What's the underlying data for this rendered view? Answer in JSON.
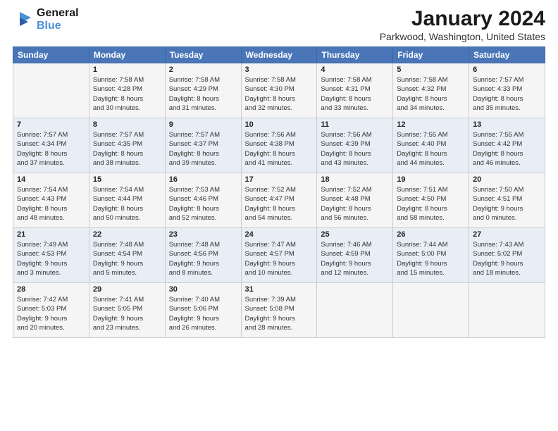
{
  "logo": {
    "line1": "General",
    "line2": "Blue"
  },
  "title": "January 2024",
  "location": "Parkwood, Washington, United States",
  "weekdays": [
    "Sunday",
    "Monday",
    "Tuesday",
    "Wednesday",
    "Thursday",
    "Friday",
    "Saturday"
  ],
  "weeks": [
    [
      {
        "day": "",
        "info": ""
      },
      {
        "day": "1",
        "info": "Sunrise: 7:58 AM\nSunset: 4:28 PM\nDaylight: 8 hours\nand 30 minutes."
      },
      {
        "day": "2",
        "info": "Sunrise: 7:58 AM\nSunset: 4:29 PM\nDaylight: 8 hours\nand 31 minutes."
      },
      {
        "day": "3",
        "info": "Sunrise: 7:58 AM\nSunset: 4:30 PM\nDaylight: 8 hours\nand 32 minutes."
      },
      {
        "day": "4",
        "info": "Sunrise: 7:58 AM\nSunset: 4:31 PM\nDaylight: 8 hours\nand 33 minutes."
      },
      {
        "day": "5",
        "info": "Sunrise: 7:58 AM\nSunset: 4:32 PM\nDaylight: 8 hours\nand 34 minutes."
      },
      {
        "day": "6",
        "info": "Sunrise: 7:57 AM\nSunset: 4:33 PM\nDaylight: 8 hours\nand 35 minutes."
      }
    ],
    [
      {
        "day": "7",
        "info": "Sunrise: 7:57 AM\nSunset: 4:34 PM\nDaylight: 8 hours\nand 37 minutes."
      },
      {
        "day": "8",
        "info": "Sunrise: 7:57 AM\nSunset: 4:35 PM\nDaylight: 8 hours\nand 38 minutes."
      },
      {
        "day": "9",
        "info": "Sunrise: 7:57 AM\nSunset: 4:37 PM\nDaylight: 8 hours\nand 39 minutes."
      },
      {
        "day": "10",
        "info": "Sunrise: 7:56 AM\nSunset: 4:38 PM\nDaylight: 8 hours\nand 41 minutes."
      },
      {
        "day": "11",
        "info": "Sunrise: 7:56 AM\nSunset: 4:39 PM\nDaylight: 8 hours\nand 43 minutes."
      },
      {
        "day": "12",
        "info": "Sunrise: 7:55 AM\nSunset: 4:40 PM\nDaylight: 8 hours\nand 44 minutes."
      },
      {
        "day": "13",
        "info": "Sunrise: 7:55 AM\nSunset: 4:42 PM\nDaylight: 8 hours\nand 46 minutes."
      }
    ],
    [
      {
        "day": "14",
        "info": "Sunrise: 7:54 AM\nSunset: 4:43 PM\nDaylight: 8 hours\nand 48 minutes."
      },
      {
        "day": "15",
        "info": "Sunrise: 7:54 AM\nSunset: 4:44 PM\nDaylight: 8 hours\nand 50 minutes."
      },
      {
        "day": "16",
        "info": "Sunrise: 7:53 AM\nSunset: 4:46 PM\nDaylight: 8 hours\nand 52 minutes."
      },
      {
        "day": "17",
        "info": "Sunrise: 7:52 AM\nSunset: 4:47 PM\nDaylight: 8 hours\nand 54 minutes."
      },
      {
        "day": "18",
        "info": "Sunrise: 7:52 AM\nSunset: 4:48 PM\nDaylight: 8 hours\nand 56 minutes."
      },
      {
        "day": "19",
        "info": "Sunrise: 7:51 AM\nSunset: 4:50 PM\nDaylight: 8 hours\nand 58 minutes."
      },
      {
        "day": "20",
        "info": "Sunrise: 7:50 AM\nSunset: 4:51 PM\nDaylight: 9 hours\nand 0 minutes."
      }
    ],
    [
      {
        "day": "21",
        "info": "Sunrise: 7:49 AM\nSunset: 4:53 PM\nDaylight: 9 hours\nand 3 minutes."
      },
      {
        "day": "22",
        "info": "Sunrise: 7:48 AM\nSunset: 4:54 PM\nDaylight: 9 hours\nand 5 minutes."
      },
      {
        "day": "23",
        "info": "Sunrise: 7:48 AM\nSunset: 4:56 PM\nDaylight: 9 hours\nand 8 minutes."
      },
      {
        "day": "24",
        "info": "Sunrise: 7:47 AM\nSunset: 4:57 PM\nDaylight: 9 hours\nand 10 minutes."
      },
      {
        "day": "25",
        "info": "Sunrise: 7:46 AM\nSunset: 4:59 PM\nDaylight: 9 hours\nand 12 minutes."
      },
      {
        "day": "26",
        "info": "Sunrise: 7:44 AM\nSunset: 5:00 PM\nDaylight: 9 hours\nand 15 minutes."
      },
      {
        "day": "27",
        "info": "Sunrise: 7:43 AM\nSunset: 5:02 PM\nDaylight: 9 hours\nand 18 minutes."
      }
    ],
    [
      {
        "day": "28",
        "info": "Sunrise: 7:42 AM\nSunset: 5:03 PM\nDaylight: 9 hours\nand 20 minutes."
      },
      {
        "day": "29",
        "info": "Sunrise: 7:41 AM\nSunset: 5:05 PM\nDaylight: 9 hours\nand 23 minutes."
      },
      {
        "day": "30",
        "info": "Sunrise: 7:40 AM\nSunset: 5:06 PM\nDaylight: 9 hours\nand 26 minutes."
      },
      {
        "day": "31",
        "info": "Sunrise: 7:39 AM\nSunset: 5:08 PM\nDaylight: 9 hours\nand 28 minutes."
      },
      {
        "day": "",
        "info": ""
      },
      {
        "day": "",
        "info": ""
      },
      {
        "day": "",
        "info": ""
      }
    ]
  ]
}
